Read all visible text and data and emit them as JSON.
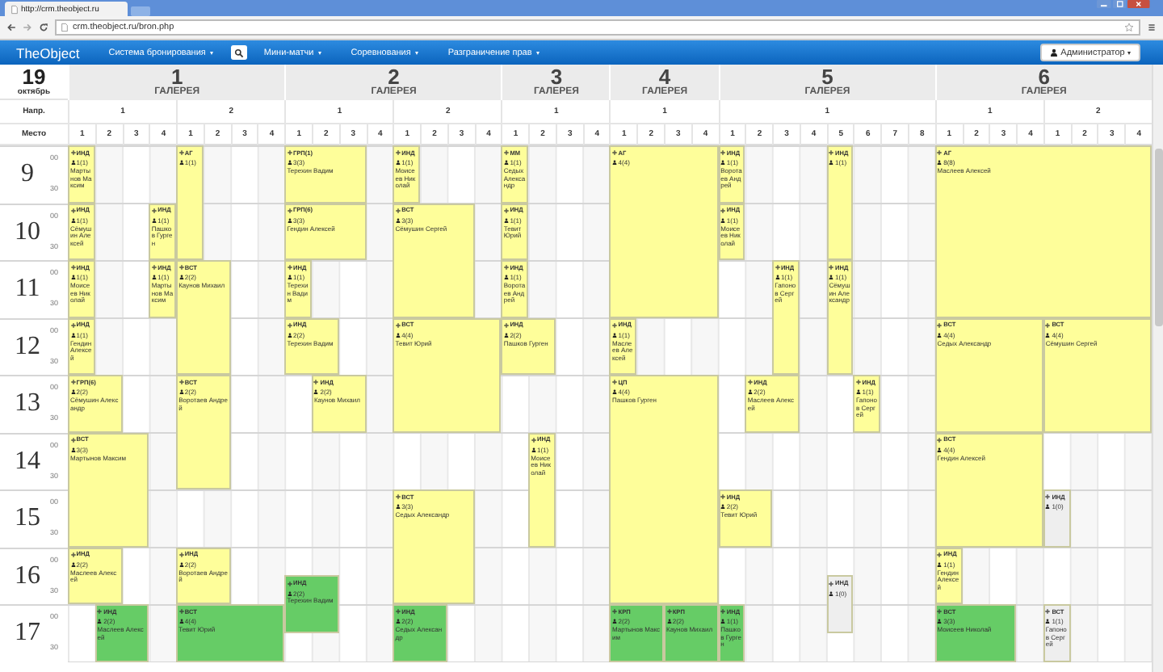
{
  "browser": {
    "tab_title": "http://crm.theobject.ru",
    "url": "crm.theobject.ru/bron.php"
  },
  "navbar": {
    "brand": "TheObject",
    "items": [
      {
        "kind": "dropdown",
        "label": "Система бронирования"
      },
      {
        "kind": "search"
      },
      {
        "kind": "dropdown",
        "label": "Мини-матчи"
      },
      {
        "kind": "dropdown",
        "label": "Соревнования"
      },
      {
        "kind": "dropdown",
        "label": "Разграничение прав"
      }
    ],
    "user": "Администратор"
  },
  "date": {
    "day": "19",
    "month": "октябрь"
  },
  "row_labels": {
    "direction": "Напр.",
    "place": "Место"
  },
  "galleries": [
    {
      "number": "1",
      "label": "ГАЛЕРЕЯ",
      "directions": [
        {
          "label": "1",
          "places": [
            "1",
            "2",
            "3",
            "4"
          ]
        },
        {
          "label": "2",
          "places": [
            "1",
            "2",
            "3",
            "4"
          ]
        }
      ]
    },
    {
      "number": "2",
      "label": "ГАЛЕРЕЯ",
      "directions": [
        {
          "label": "1",
          "places": [
            "1",
            "2",
            "3",
            "4"
          ]
        },
        {
          "label": "2",
          "places": [
            "1",
            "2",
            "3",
            "4"
          ]
        }
      ]
    },
    {
      "number": "3",
      "label": "ГАЛЕРЕЯ",
      "directions": [
        {
          "label": "1",
          "places": [
            "1",
            "2",
            "3",
            "4"
          ]
        }
      ]
    },
    {
      "number": "4",
      "label": "ГАЛЕРЕЯ",
      "directions": [
        {
          "label": "1",
          "places": [
            "1",
            "2",
            "3",
            "4"
          ]
        }
      ]
    },
    {
      "number": "5",
      "label": "ГАЛЕРЕЯ",
      "directions": [
        {
          "label": "1",
          "places": [
            "1",
            "2",
            "3",
            "4",
            "5",
            "6",
            "7",
            "8"
          ]
        }
      ]
    },
    {
      "number": "6",
      "label": "ГАЛЕРЕЯ",
      "directions": [
        {
          "label": "1",
          "places": [
            "1",
            "2",
            "3",
            "4"
          ]
        },
        {
          "label": "2",
          "places": [
            "1",
            "2",
            "3",
            "4"
          ]
        }
      ]
    }
  ],
  "hours": [
    {
      "hour": "9",
      "marks": [
        "00",
        "30"
      ]
    },
    {
      "hour": "10",
      "marks": [
        "00",
        "30"
      ]
    },
    {
      "hour": "11",
      "marks": [
        "00",
        "30"
      ]
    },
    {
      "hour": "12",
      "marks": [
        "00",
        "30"
      ]
    },
    {
      "hour": "13",
      "marks": [
        "00",
        "30"
      ]
    },
    {
      "hour": "14",
      "marks": [
        "00",
        "30"
      ]
    },
    {
      "hour": "15",
      "marks": [
        "00",
        "30"
      ]
    },
    {
      "hour": "16",
      "marks": [
        "00",
        "30"
      ]
    },
    {
      "hour": "17",
      "marks": [
        "00",
        "30"
      ]
    }
  ],
  "bookings": [
    {
      "type": "ИНД",
      "count": "1(1)",
      "name": "Мартынов Максим",
      "color": "#fefe9a"
    },
    {
      "type": "АГ",
      "count": "1(1)",
      "color": "#fefe9a"
    },
    {
      "type": "ИНД",
      "count": "1(1)",
      "name": "Сёмушин Алексей",
      "color": "#fefe9a"
    },
    {
      "type": "ИНД",
      "count": "1(1)",
      "name": "Пашков Гурген",
      "color": "#fefe9a"
    },
    {
      "type": "ИНД",
      "count": "1(1)",
      "name": "Моисеев Николай",
      "color": "#fefe9a"
    },
    {
      "type": "ИНД",
      "count": "1(1)",
      "name": "Мартынов Максим",
      "color": "#fefe9a"
    },
    {
      "type": "ВСТ",
      "count": "2(2)",
      "name": "Каунов Михаил",
      "color": "#fefe9a"
    },
    {
      "type": "ИНД",
      "count": "1(1)",
      "name": "Гендин Алексей",
      "color": "#fefe9a"
    },
    {
      "type": "ГРП(6)",
      "count": "2(2)",
      "name": "Сёмушин Александр",
      "color": "#fefe9a"
    },
    {
      "type": "ВСТ",
      "count": "2(2)",
      "name": "Воротаев Андрей",
      "color": "#fefe9a"
    },
    {
      "type": "ВСТ",
      "count": "3(3)",
      "name": "Мартынов Максим",
      "color": "#fefe9a"
    },
    {
      "type": "ИНД",
      "count": "2(2)",
      "name": "Маслеев Алексей",
      "color": "#fefe9a"
    },
    {
      "type": "ИНД",
      "count": "2(2)",
      "name": "Воротаев Андрей",
      "color": "#fefe9a"
    },
    {
      "type": "ИНД",
      "count": "2(2)",
      "name": "Маслеев Алексей",
      "color": "#66cc66"
    },
    {
      "type": "ВСТ",
      "count": "4(4)",
      "name": "Тевит Юрий",
      "color": "#66cc66"
    },
    {
      "type": "ГРП(1)",
      "count": "3(3)",
      "name": "Терехин Вадим",
      "color": "#fefe9a"
    },
    {
      "type": "ИНД",
      "count": "1(1)",
      "name": "Моисеев Николай",
      "color": "#fefe9a"
    },
    {
      "type": "ГРП(6)",
      "count": "3(3)",
      "name": "Гендин Алексей",
      "color": "#fefe9a"
    },
    {
      "type": "ВСТ",
      "count": "3(3)",
      "name": "Сёмушин Сергей",
      "color": "#fefe9a"
    },
    {
      "type": "ИНД",
      "count": "1(1)",
      "name": "Терехин Вадим",
      "color": "#fefe9a"
    },
    {
      "type": "ИНД",
      "count": "2(2)",
      "name": "Терехин Вадим",
      "color": "#fefe9a"
    },
    {
      "type": "ВСТ",
      "count": "4(4)",
      "name": "Тевит Юрий",
      "color": "#fefe9a"
    },
    {
      "type": "ИНД",
      "count": "2(2)",
      "name": "Каунов Михаил",
      "color": "#fefe9a"
    },
    {
      "type": "ВСТ",
      "count": "3(3)",
      "name": "Седых Александр",
      "color": "#fefe9a"
    },
    {
      "type": "ИНД",
      "count": "2(2)",
      "name": "Терехин Вадим",
      "color": "#66cc66"
    },
    {
      "type": "ИНД",
      "count": "2(2)",
      "name": "Седых Александр",
      "color": "#66cc66"
    },
    {
      "type": "ММ",
      "count": "1(1)",
      "name": "Седых Александр",
      "color": "#fefe9a"
    },
    {
      "type": "ИНД",
      "count": "1(1)",
      "name": "Тевит Юрий",
      "color": "#fefe9a"
    },
    {
      "type": "ИНД",
      "count": "1(1)",
      "name": "Воротаев Андрей",
      "color": "#fefe9a"
    },
    {
      "type": "ИНД",
      "count": "2(2)",
      "name": "Пашков Гурген",
      "color": "#fefe9a"
    },
    {
      "type": "ИНД",
      "count": "1(1)",
      "name": "Моисеев Николай",
      "color": "#fefe9a"
    },
    {
      "type": "АГ",
      "count": "4(4)",
      "color": "#fefe9a"
    },
    {
      "type": "ИНД",
      "count": "1(1)",
      "name": "Маслеев Алексей",
      "color": "#fefe9a"
    },
    {
      "type": "ЦП",
      "count": "4(4)",
      "name": "Пашков Гурген",
      "color": "#fefe9a"
    },
    {
      "type": "КРП",
      "count": "2(2)",
      "name": "Мартынов Максим",
      "color": "#66cc66"
    },
    {
      "type": "КРП",
      "count": "2(2)",
      "name": "Каунов Михаил",
      "color": "#66cc66"
    },
    {
      "type": "ИНД",
      "count": "1(1)",
      "name": "Воротаев Андрей",
      "color": "#fefe9a"
    },
    {
      "type": "ИНД",
      "count": "1(1)",
      "color": "#fefe9a"
    },
    {
      "type": "ИНД",
      "count": "1(1)",
      "name": "Моисеев Николай",
      "color": "#fefe9a"
    },
    {
      "type": "ИНД",
      "count": "1(1)",
      "name": "Гапонов Сергей",
      "color": "#fefe9a"
    },
    {
      "type": "ИНД",
      "count": "1(1)",
      "name": "Сёмушин Александр",
      "color": "#fefe9a"
    },
    {
      "type": "ИНД",
      "count": "2(2)",
      "name": "Маслеев Алексей",
      "color": "#fefe9a"
    },
    {
      "type": "ИНД",
      "count": "1(1)",
      "name": "Гапонов Сергей",
      "color": "#fefe9a"
    },
    {
      "type": "ИНД",
      "count": "2(2)",
      "name": "Тевит Юрий",
      "color": "#fefe9a"
    },
    {
      "type": "ИНД",
      "count": "1(0)",
      "color": "#eeeeee"
    },
    {
      "type": "ИНД",
      "count": "1(1)",
      "name": "Пашков Гурген",
      "color": "#66cc66"
    },
    {
      "type": "АГ",
      "count": "8(8)",
      "name": "Маслеев Алексей",
      "color": "#fefe9a"
    },
    {
      "type": "ВСТ",
      "count": "4(4)",
      "name": "Седых Александр",
      "color": "#fefe9a"
    },
    {
      "type": "ВСТ",
      "count": "4(4)",
      "name": "Сёмушин Сергей",
      "color": "#fefe9a"
    },
    {
      "type": "ВСТ",
      "count": "4(4)",
      "name": "Гендин Алексей",
      "color": "#fefe9a"
    },
    {
      "type": "ИНД",
      "count": "1(0)",
      "color": "#eeeeee"
    },
    {
      "type": "ИНД",
      "count": "1(1)",
      "name": "Гендин Алексей",
      "color": "#fefe9a"
    },
    {
      "type": "ВСТ",
      "count": "3(3)",
      "name": "Моисеев Николай",
      "color": "#66cc66"
    },
    {
      "type": "ВСТ",
      "count": "1(1)",
      "name": "Гапонов Сергей",
      "color": "#eeeeee"
    }
  ]
}
